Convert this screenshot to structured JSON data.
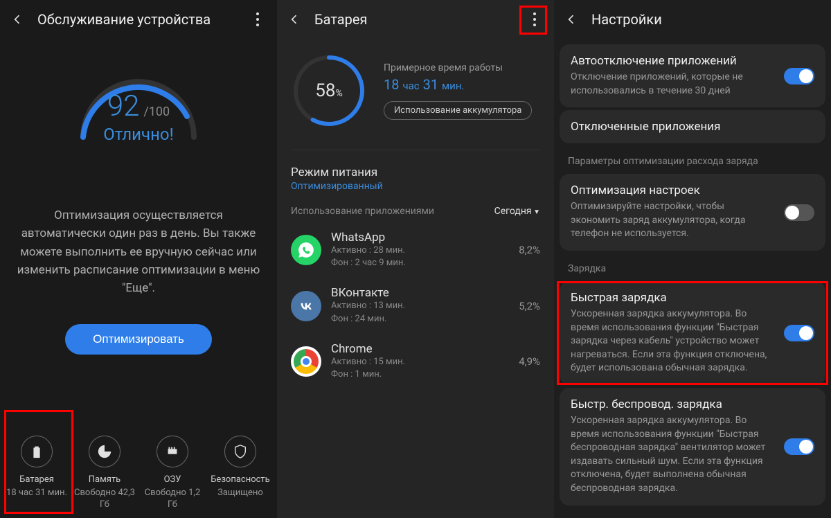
{
  "panel1": {
    "title": "Обслуживание устройства",
    "score": "92",
    "score_of": "/100",
    "score_label": "Отлично!",
    "description": "Оптимизация осуществляется автоматически один раз в день. Вы также можете выполнить ее вручную сейчас или изменить расписание оптимизации в меню \"Еще\".",
    "optimize_button": "Оптимизировать",
    "stats": [
      {
        "label": "Батарея",
        "value": "18 час 31 мин."
      },
      {
        "label": "Память",
        "value": "Свободно 42,3 Гб"
      },
      {
        "label": "ОЗУ",
        "value": "Свободно 1,2 Гб"
      },
      {
        "label": "Безопасность",
        "value": "Защищено"
      }
    ]
  },
  "panel2": {
    "title": "Батарея",
    "percent": "58",
    "time_label": "Примерное время работы",
    "time_value_h": "18",
    "time_unit_h": "час",
    "time_value_m": "31",
    "time_unit_m": "мин.",
    "usage_pill": "Использование аккумулятора",
    "power_mode": "Режим питания",
    "power_mode_status": "Оптимизированный",
    "usage_header": "Использование приложениями",
    "today": "Сегодня",
    "apps": [
      {
        "name": "WhatsApp",
        "active": "Активно : 28 мин.",
        "bg": "Фон : 2 час 9 мин.",
        "pct": "8,2%"
      },
      {
        "name": "ВКонтакте",
        "active": "Активно : 13 мин.",
        "bg": "Фон : 24 мин.",
        "pct": "5,2%"
      },
      {
        "name": "Chrome",
        "active": "Активно : 15 мин.",
        "bg": "Фон : 1 мин.",
        "pct": "4,9%"
      }
    ]
  },
  "panel3": {
    "title": "Настройки",
    "settings": {
      "auto_disable": {
        "title": "Автоотключение приложений",
        "desc": "Отключение приложений, которые не использовались в течение 30 дней"
      },
      "disabled_apps": {
        "title": "Отключенные приложения"
      },
      "opt_section": "Параметры оптимизации расхода заряда",
      "opt_settings": {
        "title": "Оптимизация настроек",
        "desc": "Оптимизируйте настройки, чтобы экономить заряд аккумулятора, когда телефон не используется."
      },
      "charge_section": "Зарядка",
      "fast_charge": {
        "title": "Быстрая зарядка",
        "desc": "Ускоренная зарядка аккумулятора. Во время использования функции \"Быстрая зарядка через кабель\" устройство может нагреваться. Если эта функция отключена, будет использована обычная зарядка."
      },
      "wireless_charge": {
        "title": "Быстр. беспровод. зарядка",
        "desc": "Ускоренная зарядка аккумулятора. Во время использования функции \"Быстрая беспроводная зарядка\" вентилятор может издавать сильный шум. Если эта функция отключена, будет выполнена обычная беспроводная зарядка."
      }
    }
  }
}
